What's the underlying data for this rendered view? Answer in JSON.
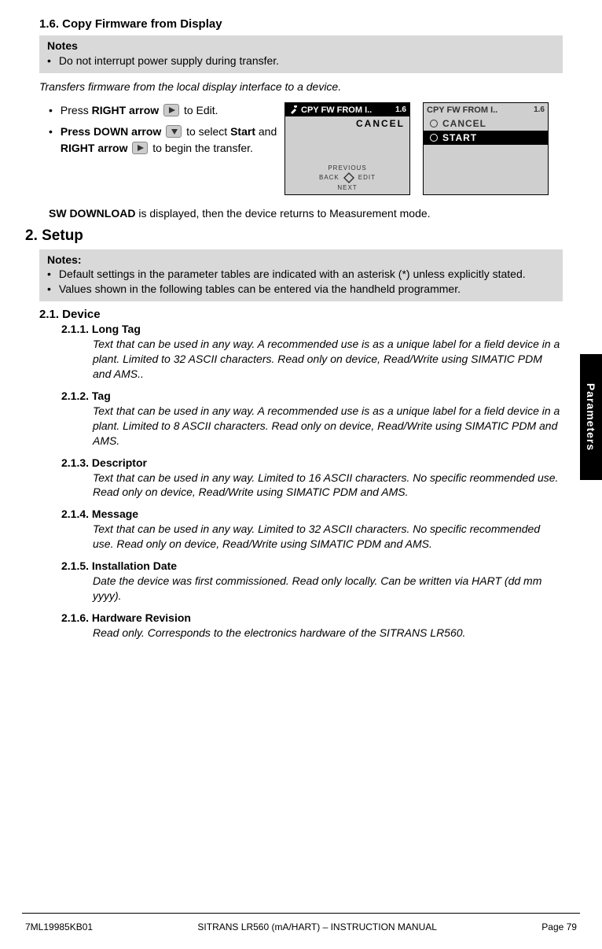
{
  "sideTab": "Parameters",
  "sec16": {
    "title": "1.6.  Copy Firmware from Display",
    "notesTitle": "Notes",
    "note1": "Do not interrupt power supply during transfer.",
    "desc": "Transfers firmware from the local display interface to a device.",
    "step1_a": "Press ",
    "step1_b": "RIGHT arrow",
    "step1_c": " to Edit.",
    "step2_a": "Press DOWN arrow",
    "step2_b": " to select ",
    "step2_c": "Start ",
    "step2_d": "and ",
    "step2_e": "RIGHT arrow",
    "step2_f": " to begin the transfer.",
    "lcd1": {
      "title": "CPY FW FROM I..",
      "ver": "1.6",
      "cancel": "CANCEL",
      "prev": "PREVIOUS",
      "back": "BACK",
      "edit": "EDIT",
      "next": "NEXT"
    },
    "lcd2": {
      "title": "CPY FW FROM I..",
      "ver": "1.6",
      "opt1": "CANCEL",
      "opt2": "START"
    },
    "after_a": "SW DOWNLOAD",
    "after_b": " is displayed, then the device returns to Measurement mode."
  },
  "sec2": {
    "title": "2. Setup",
    "notesTitle": "Notes:",
    "note1": "Default settings in the parameter tables are indicated with an asterisk (*) unless explicitly stated.",
    "note2": "Values shown in the following tables can be entered via the handheld programmer.",
    "s21": "2.1.  Device",
    "entries": [
      {
        "num": "2.1.1.  Long Tag",
        "body": "Text that can be used in any way. A recommended use is as a unique label for a field device in a plant. Limited to 32 ASCII characters. Read only on device, Read/Write using SIMATIC PDM and AMS.."
      },
      {
        "num": "2.1.2.  Tag",
        "body": "Text that can be used in any way. A recommended use is as a unique label for a field device in a plant. Limited to 8 ASCII characters. Read only on device, Read/Write using SIMATIC PDM and AMS."
      },
      {
        "num": "2.1.3.  Descriptor",
        "body": "Text that can be used in any way. Limited to 16 ASCII characters. No specific reommended use. Read only on device, Read/Write using SIMATIC PDM and AMS."
      },
      {
        "num": "2.1.4.  Message",
        "body": "Text that can be used in any way. Limited to 32 ASCII characters. No specific recommended use. Read only on device, Read/Write using SIMATIC PDM and AMS."
      },
      {
        "num": "2.1.5.  Installation Date",
        "body": "Date the device was first commissioned. Read only locally. Can be written via HART (dd mm yyyy)."
      },
      {
        "num": "2.1.6.  Hardware Revision",
        "body": "Read only. Corresponds to the electronics hardware of the SITRANS LR560."
      }
    ]
  },
  "footer": {
    "left": "7ML19985KB01",
    "mid": "SITRANS LR560 (mA/HART) – INSTRUCTION MANUAL",
    "right": "Page 79"
  }
}
